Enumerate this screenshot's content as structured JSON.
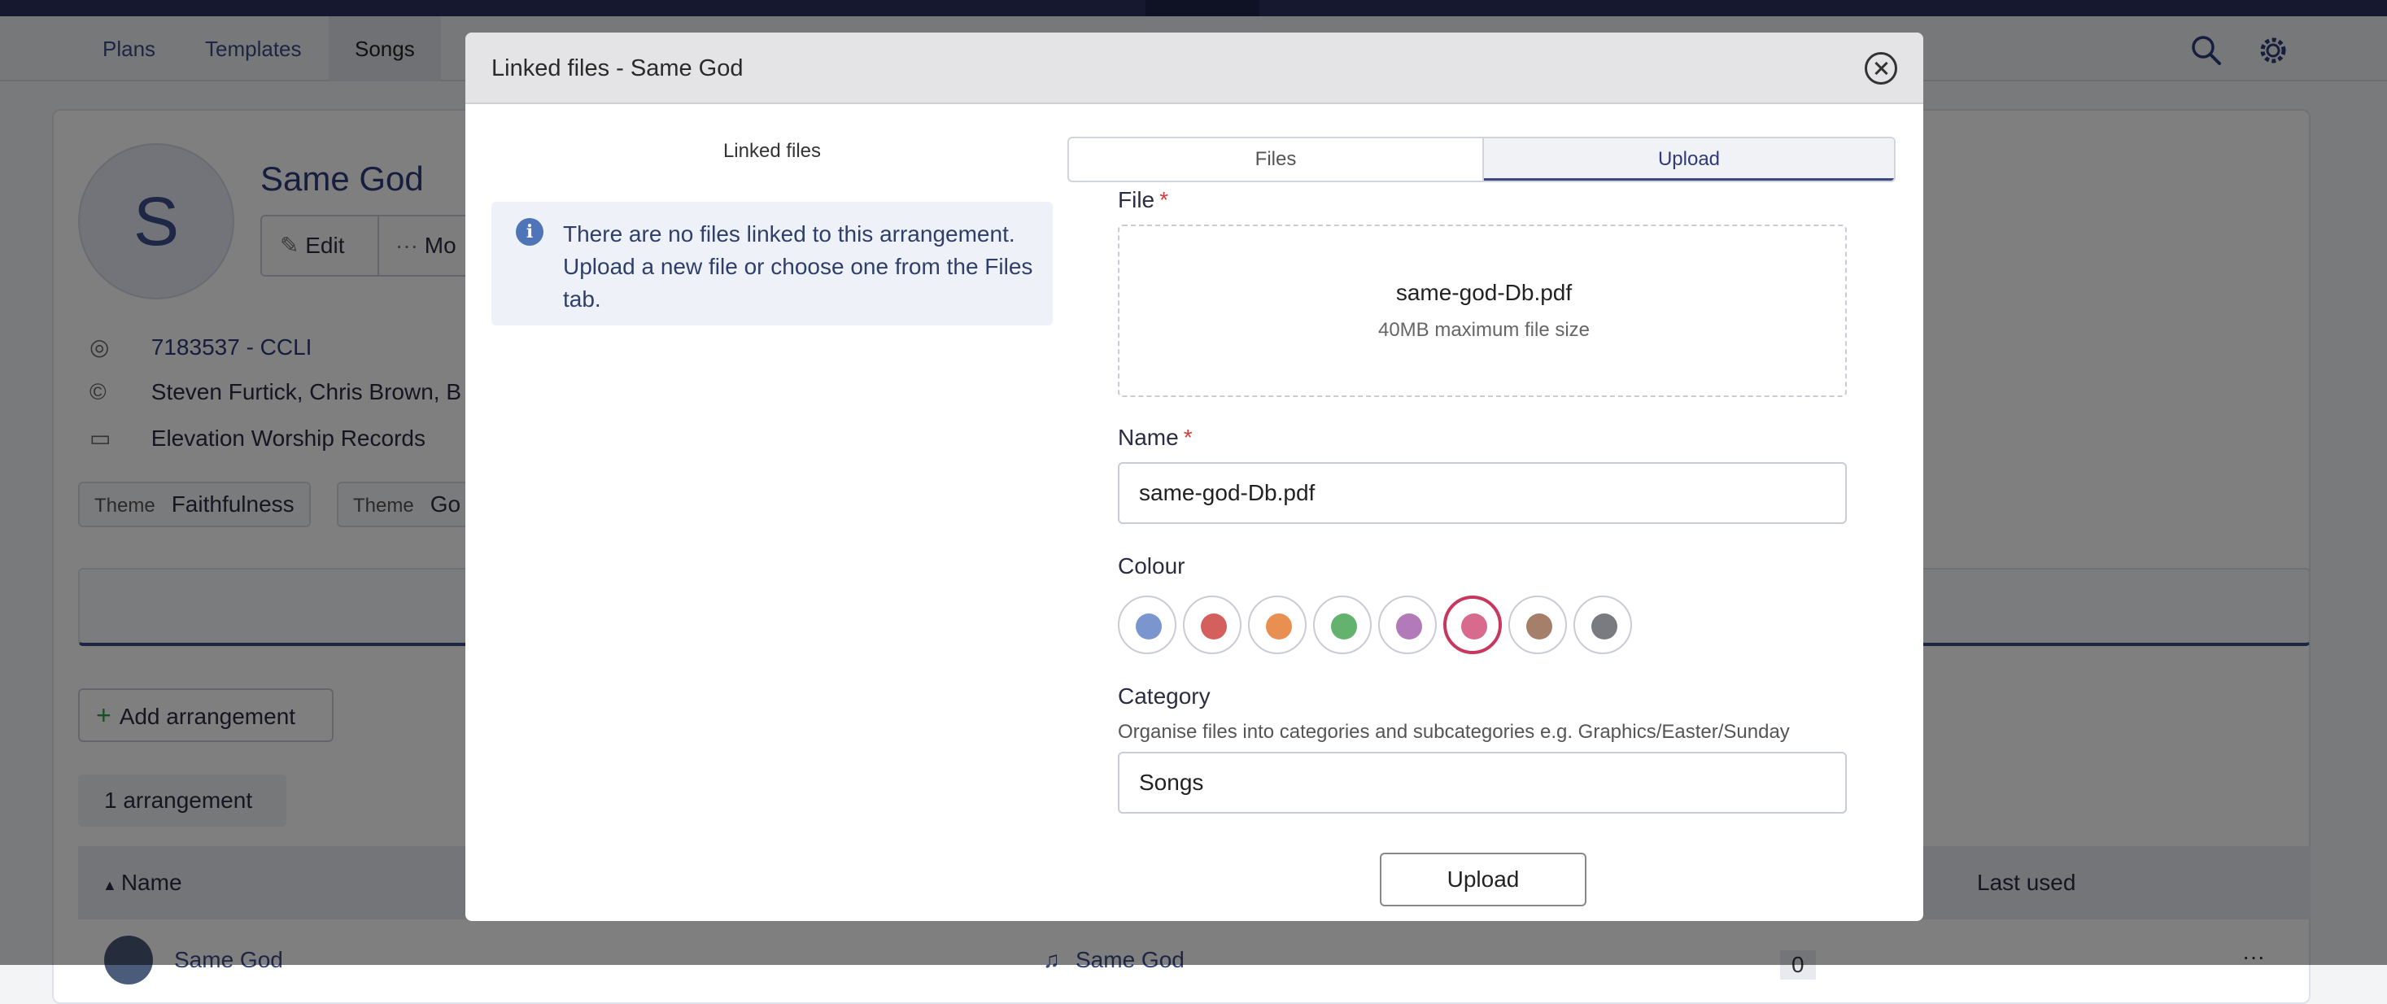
{
  "nav": {
    "tabs": [
      {
        "label": "Plans"
      },
      {
        "label": "Templates"
      },
      {
        "label": "Songs"
      }
    ],
    "active_tab": "Songs",
    "icons": [
      "search-icon",
      "gear-icon"
    ]
  },
  "song": {
    "avatar_letter": "S",
    "title": "Same God",
    "edit_label": "Edit",
    "more_label": "Mo",
    "ccli": "7183537 - CCLI",
    "authors": "Steven Furtick, Chris Brown, B",
    "publisher": "Elevation Worship Records",
    "tags": [
      {
        "key": "Theme",
        "value": "Faithfulness"
      },
      {
        "key": "Theme",
        "value": "Go"
      }
    ],
    "add_arrangement_label": "Add arrangement",
    "arrangement_count": "1 arrangement",
    "table_headers": {
      "name": "Name",
      "last_used": "Last used"
    },
    "row_peek": {
      "name": "Same God",
      "arrangement": "Same God",
      "count": "0"
    }
  },
  "modal": {
    "title": "Linked files - Same God",
    "left_title": "Linked files",
    "info_text": "There are no files linked to this arrangement. Upload a new file or choose one from the Files tab.",
    "tabs": [
      {
        "label": "Files"
      },
      {
        "label": "Upload"
      }
    ],
    "active_tab": "Upload",
    "file_label": "File",
    "file_name": "same-god-Db.pdf",
    "file_hint": "40MB maximum file size",
    "name_label": "Name",
    "name_value": "same-god-Db.pdf",
    "colour_label": "Colour",
    "colours": [
      "#7b96cf",
      "#d4605e",
      "#e98f52",
      "#63b26e",
      "#b27ab9",
      "#d86a8e",
      "#a57f6a",
      "#7a7b80"
    ],
    "selected_colour": "#d86a8e",
    "category_label": "Category",
    "category_hint": "Organise files into categories and subcategories e.g. Graphics/Easter/Sunday",
    "category_value": "Songs",
    "upload_button": "Upload"
  }
}
